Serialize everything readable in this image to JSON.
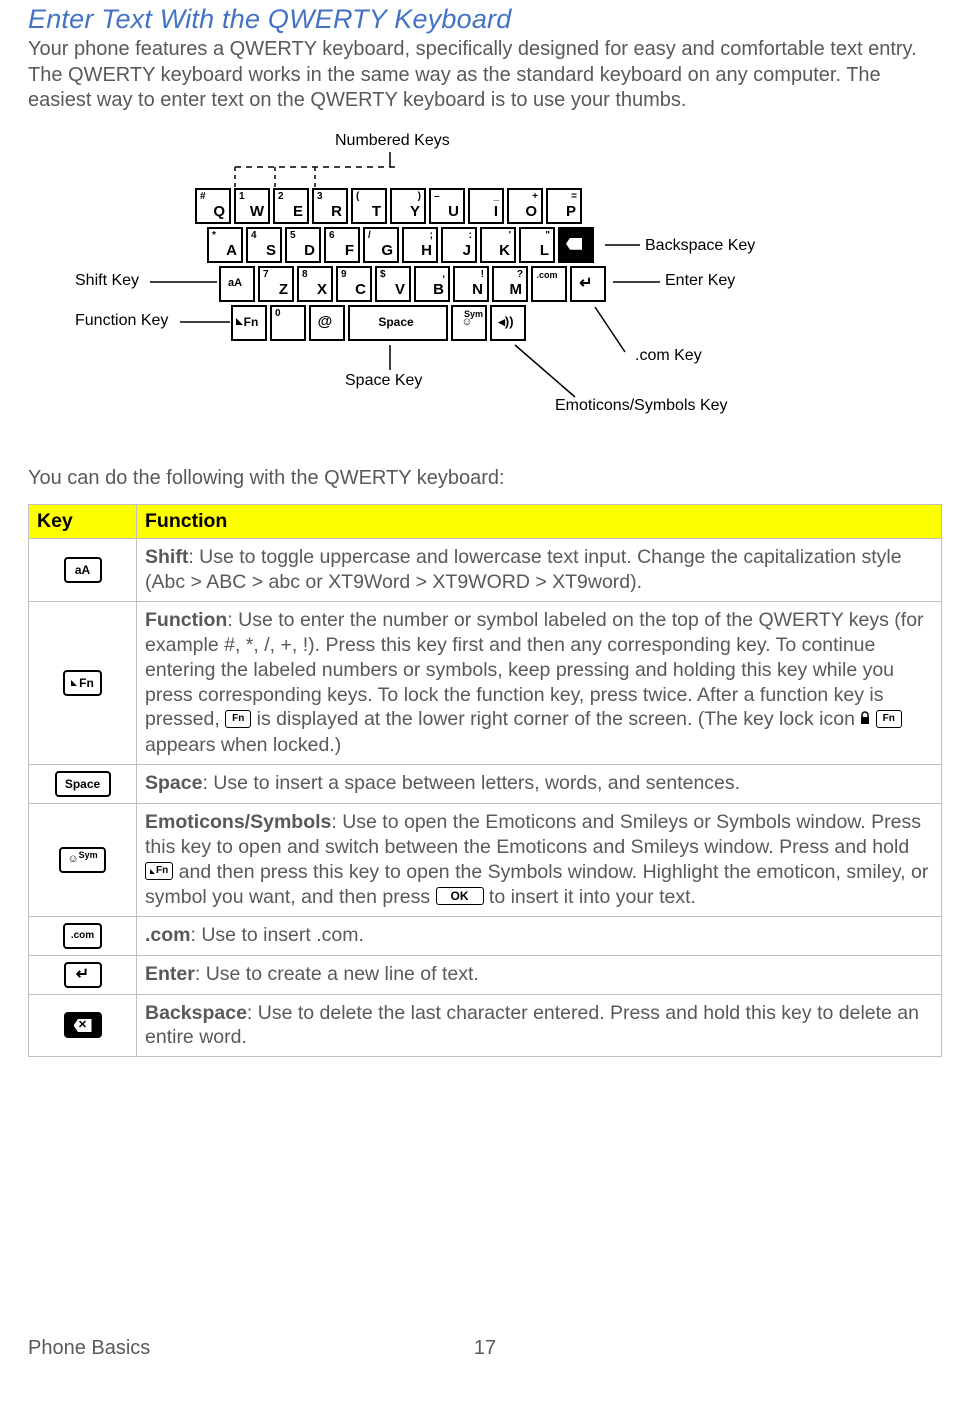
{
  "title": "Enter Text With the QWERTY Keyboard",
  "intro": "Your phone features a QWERTY keyboard, specifically designed for easy and comfortable text entry. The QWERTY keyboard works in the same way as the standard keyboard on any computer. The easiest way to enter text on the QWERTY keyboard is to use your thumbs.",
  "subintro": "You can do the following with the QWERTY keyboard:",
  "diagram": {
    "numbered_keys": "Numbered Keys",
    "shift_key": "Shift Key",
    "function_key": "Function Key",
    "space_key": "Space Key",
    "backspace_key": "Backspace Key",
    "enter_key": "Enter Key",
    "com_key": ".com Key",
    "emoticons_key": "Emoticons/Symbols Key",
    "space_label": "Space",
    "keys": {
      "row1": [
        {
          "sup": "#",
          "main": "Q"
        },
        {
          "sup": "1",
          "main": "W"
        },
        {
          "sup": "2",
          "main": "E"
        },
        {
          "sup": "3",
          "main": "R"
        },
        {
          "sup": "(",
          "main": "T"
        },
        {
          "supR": ")",
          "main": "Y"
        },
        {
          "sup": "–",
          "main": "U"
        },
        {
          "supR": "_",
          "main": "I"
        },
        {
          "supR": "+",
          "main": "O"
        },
        {
          "supR": "=",
          "main": "P"
        }
      ],
      "row2": [
        {
          "sup": "*",
          "main": "A"
        },
        {
          "sup": "4",
          "main": "S"
        },
        {
          "sup": "5",
          "main": "D"
        },
        {
          "sup": "6",
          "main": "F"
        },
        {
          "sup": "/",
          "main": "G"
        },
        {
          "supR": ";",
          "main": "H"
        },
        {
          "supR": ":",
          "main": "J"
        },
        {
          "supR": "'",
          "main": "K"
        },
        {
          "supR": "\"",
          "main": "L"
        }
      ],
      "row3": [
        {
          "sup": "7",
          "main": "Z"
        },
        {
          "sup": "8",
          "main": "X"
        },
        {
          "sup": "9",
          "main": "C"
        },
        {
          "sup": "$",
          "main": "V"
        },
        {
          "supR": ",",
          "main": "B"
        },
        {
          "supR": "!",
          "main": "N"
        },
        {
          "supR": "?",
          "main": "M"
        }
      ],
      "aA": "aA",
      "fn": "Fn",
      "zero": "0",
      "at": "@",
      "sym": "Sym",
      "com": ".com",
      "enter": "↵",
      "speaker": "◂))"
    }
  },
  "table": {
    "headers": {
      "key": "Key",
      "function": "Function"
    },
    "rows": {
      "shift": {
        "cap": "aA",
        "bold": "Shift",
        "text": ": Use to toggle uppercase and lowercase text input. Change the capitalization style (Abc > ABC > abc or XT9Word > XT9WORD > XT9word)."
      },
      "function": {
        "cap": "Fn",
        "bold": "Function",
        "text1": ": Use to enter the number or symbol labeled on the top of the QWERTY keys (for example #, *, /, +, !). Press this key first and then any corresponding key. To continue entering the labeled numbers or symbols, keep pressing and holding this key while you press corresponding keys. To lock the function key, press twice. After a function key is pressed, ",
        "text2": " is displayed at the lower right corner of the screen. (The key lock icon ",
        "text3": " appears when locked.)",
        "inlineFn": "Fn"
      },
      "space": {
        "cap": "Space",
        "bold": "Space",
        "text": ": Use to insert a space between letters, words, and sentences."
      },
      "emoticons": {
        "cap": "Sym",
        "bold": "Emoticons/Symbols",
        "text1": ": Use to open the Emoticons and Smileys or Symbols window. Press this key to open and switch between the Emoticons and Smileys window. Press and hold ",
        "text2": " and then press this key to open the Symbols window. Highlight the emoticon, smiley, or symbol you want, and then press ",
        "text3": " to insert it into your text.",
        "inlineFn": "Fn",
        "inlineOK": "OK"
      },
      "com": {
        "cap": ".com",
        "bold": ".com",
        "text": ": Use to insert .com."
      },
      "enter": {
        "bold": "Enter",
        "text": ": Use to create a new line of text."
      },
      "backspace": {
        "bold": "Backspace",
        "text": ": Use to delete the last character entered. Press and hold this key to delete an entire word."
      }
    }
  },
  "footer": {
    "section": "Phone Basics",
    "page": "17"
  }
}
